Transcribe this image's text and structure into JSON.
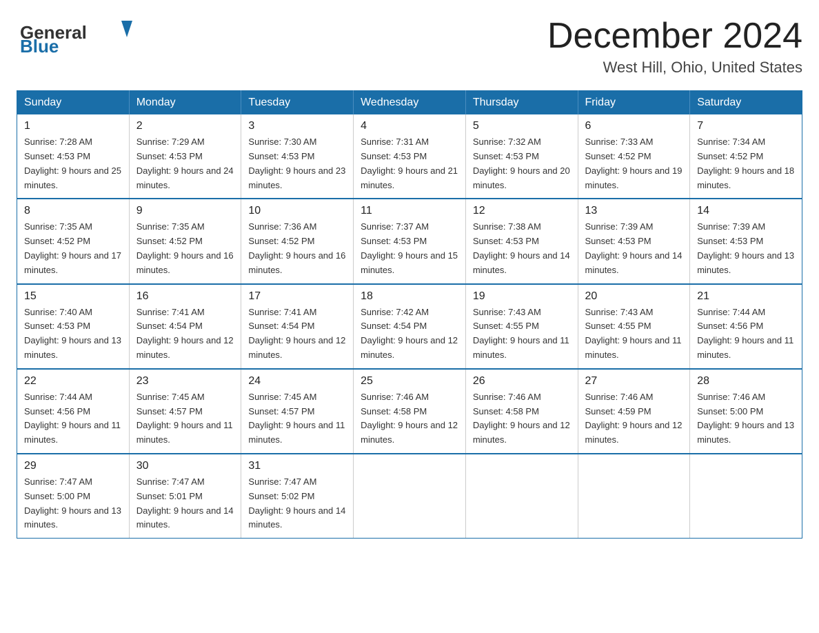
{
  "header": {
    "logo_general": "General",
    "logo_blue": "Blue",
    "month_title": "December 2024",
    "location": "West Hill, Ohio, United States"
  },
  "days_of_week": [
    "Sunday",
    "Monday",
    "Tuesday",
    "Wednesday",
    "Thursday",
    "Friday",
    "Saturday"
  ],
  "weeks": [
    [
      {
        "day": "1",
        "sunrise": "7:28 AM",
        "sunset": "4:53 PM",
        "daylight": "9 hours and 25 minutes."
      },
      {
        "day": "2",
        "sunrise": "7:29 AM",
        "sunset": "4:53 PM",
        "daylight": "9 hours and 24 minutes."
      },
      {
        "day": "3",
        "sunrise": "7:30 AM",
        "sunset": "4:53 PM",
        "daylight": "9 hours and 23 minutes."
      },
      {
        "day": "4",
        "sunrise": "7:31 AM",
        "sunset": "4:53 PM",
        "daylight": "9 hours and 21 minutes."
      },
      {
        "day": "5",
        "sunrise": "7:32 AM",
        "sunset": "4:53 PM",
        "daylight": "9 hours and 20 minutes."
      },
      {
        "day": "6",
        "sunrise": "7:33 AM",
        "sunset": "4:52 PM",
        "daylight": "9 hours and 19 minutes."
      },
      {
        "day": "7",
        "sunrise": "7:34 AM",
        "sunset": "4:52 PM",
        "daylight": "9 hours and 18 minutes."
      }
    ],
    [
      {
        "day": "8",
        "sunrise": "7:35 AM",
        "sunset": "4:52 PM",
        "daylight": "9 hours and 17 minutes."
      },
      {
        "day": "9",
        "sunrise": "7:35 AM",
        "sunset": "4:52 PM",
        "daylight": "9 hours and 16 minutes."
      },
      {
        "day": "10",
        "sunrise": "7:36 AM",
        "sunset": "4:52 PM",
        "daylight": "9 hours and 16 minutes."
      },
      {
        "day": "11",
        "sunrise": "7:37 AM",
        "sunset": "4:53 PM",
        "daylight": "9 hours and 15 minutes."
      },
      {
        "day": "12",
        "sunrise": "7:38 AM",
        "sunset": "4:53 PM",
        "daylight": "9 hours and 14 minutes."
      },
      {
        "day": "13",
        "sunrise": "7:39 AM",
        "sunset": "4:53 PM",
        "daylight": "9 hours and 14 minutes."
      },
      {
        "day": "14",
        "sunrise": "7:39 AM",
        "sunset": "4:53 PM",
        "daylight": "9 hours and 13 minutes."
      }
    ],
    [
      {
        "day": "15",
        "sunrise": "7:40 AM",
        "sunset": "4:53 PM",
        "daylight": "9 hours and 13 minutes."
      },
      {
        "day": "16",
        "sunrise": "7:41 AM",
        "sunset": "4:54 PM",
        "daylight": "9 hours and 12 minutes."
      },
      {
        "day": "17",
        "sunrise": "7:41 AM",
        "sunset": "4:54 PM",
        "daylight": "9 hours and 12 minutes."
      },
      {
        "day": "18",
        "sunrise": "7:42 AM",
        "sunset": "4:54 PM",
        "daylight": "9 hours and 12 minutes."
      },
      {
        "day": "19",
        "sunrise": "7:43 AM",
        "sunset": "4:55 PM",
        "daylight": "9 hours and 11 minutes."
      },
      {
        "day": "20",
        "sunrise": "7:43 AM",
        "sunset": "4:55 PM",
        "daylight": "9 hours and 11 minutes."
      },
      {
        "day": "21",
        "sunrise": "7:44 AM",
        "sunset": "4:56 PM",
        "daylight": "9 hours and 11 minutes."
      }
    ],
    [
      {
        "day": "22",
        "sunrise": "7:44 AM",
        "sunset": "4:56 PM",
        "daylight": "9 hours and 11 minutes."
      },
      {
        "day": "23",
        "sunrise": "7:45 AM",
        "sunset": "4:57 PM",
        "daylight": "9 hours and 11 minutes."
      },
      {
        "day": "24",
        "sunrise": "7:45 AM",
        "sunset": "4:57 PM",
        "daylight": "9 hours and 11 minutes."
      },
      {
        "day": "25",
        "sunrise": "7:46 AM",
        "sunset": "4:58 PM",
        "daylight": "9 hours and 12 minutes."
      },
      {
        "day": "26",
        "sunrise": "7:46 AM",
        "sunset": "4:58 PM",
        "daylight": "9 hours and 12 minutes."
      },
      {
        "day": "27",
        "sunrise": "7:46 AM",
        "sunset": "4:59 PM",
        "daylight": "9 hours and 12 minutes."
      },
      {
        "day": "28",
        "sunrise": "7:46 AM",
        "sunset": "5:00 PM",
        "daylight": "9 hours and 13 minutes."
      }
    ],
    [
      {
        "day": "29",
        "sunrise": "7:47 AM",
        "sunset": "5:00 PM",
        "daylight": "9 hours and 13 minutes."
      },
      {
        "day": "30",
        "sunrise": "7:47 AM",
        "sunset": "5:01 PM",
        "daylight": "9 hours and 14 minutes."
      },
      {
        "day": "31",
        "sunrise": "7:47 AM",
        "sunset": "5:02 PM",
        "daylight": "9 hours and 14 minutes."
      },
      null,
      null,
      null,
      null
    ]
  ]
}
